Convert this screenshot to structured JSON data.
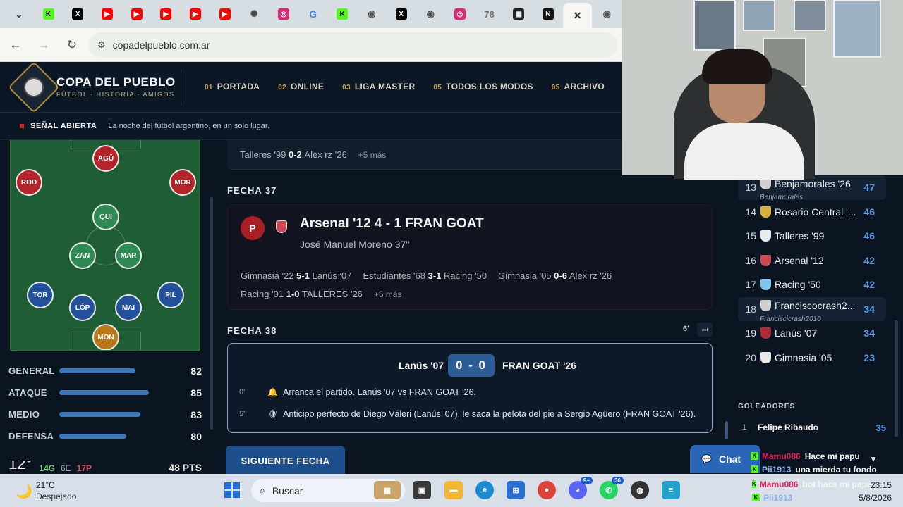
{
  "browser": {
    "tabs": [
      {
        "icon": "expand-tabs-icon",
        "color": "#3a8a3a",
        "glyph": "⌄"
      },
      {
        "icon": "kick-icon",
        "color": "#53fc18",
        "glyph": "K"
      },
      {
        "icon": "x-icon",
        "color": "#000000",
        "glyph": "X"
      },
      {
        "icon": "youtube-icon",
        "color": "#ff0000",
        "glyph": "▶"
      },
      {
        "icon": "youtube-icon",
        "color": "#ff0000",
        "glyph": "▶"
      },
      {
        "icon": "youtube-icon",
        "color": "#ff0000",
        "glyph": "▶"
      },
      {
        "icon": "youtube-icon",
        "color": "#ff0000",
        "glyph": "▶"
      },
      {
        "icon": "youtube-icon",
        "color": "#ff0000",
        "glyph": "▶"
      },
      {
        "icon": "openai-icon",
        "color": "#444444",
        "glyph": "✺"
      },
      {
        "icon": "instagram-icon",
        "color": "#d62976",
        "glyph": "◎"
      },
      {
        "icon": "google-icon",
        "color": "#4285f4",
        "glyph": "G"
      },
      {
        "icon": "kick-icon",
        "color": "#53fc18",
        "glyph": "K"
      },
      {
        "icon": "chrome-icon",
        "color": "#555555",
        "glyph": "◉"
      },
      {
        "icon": "x-icon",
        "color": "#000000",
        "glyph": "X"
      },
      {
        "icon": "chrome-icon",
        "color": "#555555",
        "glyph": "◉"
      },
      {
        "icon": "instagram-icon",
        "color": "#d62976",
        "glyph": "◎"
      },
      {
        "icon": "site-icon",
        "color": "#777777",
        "glyph": "78"
      },
      {
        "icon": "grid-icon",
        "color": "#222222",
        "glyph": "▦"
      },
      {
        "icon": "site-icon",
        "color": "#111111",
        "glyph": "N"
      },
      {
        "icon": "close-icon",
        "color": "#333333",
        "glyph": "✕",
        "active": true
      },
      {
        "icon": "chrome-icon",
        "color": "#555555",
        "glyph": "◉"
      }
    ],
    "url": "copadelpueblo.com.ar"
  },
  "site": {
    "brand_title": "COPA DEL PUEBLO",
    "brand_sub": "FÚTBOL · HISTORIA · AMIGOS",
    "nav": [
      {
        "num": "01",
        "label": "PORTADA"
      },
      {
        "num": "02",
        "label": "ONLINE"
      },
      {
        "num": "03",
        "label": "LIGA MASTER"
      },
      {
        "num": "05",
        "label": "TODOS LOS MODOS"
      },
      {
        "num": "05",
        "label": "ARCHIVO"
      }
    ],
    "ticker_label": "SEÑAL ABIERTA",
    "ticker_text": "La noche del fútbol argentino, en un solo lugar."
  },
  "pitch": {
    "players": [
      {
        "code": "AGÜ",
        "color": "red"
      },
      {
        "code": "ROD",
        "color": "red"
      },
      {
        "code": "MOR",
        "color": "red"
      },
      {
        "code": "QUI",
        "color": "green"
      },
      {
        "code": "ZAN",
        "color": "green"
      },
      {
        "code": "MAR",
        "color": "green"
      },
      {
        "code": "TOR",
        "color": "blue"
      },
      {
        "code": "PIL",
        "color": "blue"
      },
      {
        "code": "LÓP",
        "color": "blue"
      },
      {
        "code": "MAI",
        "color": "blue"
      },
      {
        "code": "MON",
        "color": "gold"
      }
    ]
  },
  "stats": [
    {
      "label": "GENERAL",
      "value": "82",
      "fill": 0.84
    },
    {
      "label": "ATAQUE",
      "value": "85",
      "fill": 0.99
    },
    {
      "label": "MEDIO",
      "value": "83",
      "fill": 0.9
    },
    {
      "label": "DEFENSA",
      "value": "80",
      "fill": 0.74
    }
  ],
  "team_summary": {
    "temp": "12°",
    "g": "14G",
    "e": "6E",
    "p": "17P",
    "pts": "48 PTS"
  },
  "prev_results": {
    "home": "Talleres '99",
    "score": "0-2",
    "away": "Alex rz '26",
    "more": "+5 más"
  },
  "fecha37": {
    "heading": "FECHA 37",
    "badge": "P",
    "score_line": "Arsenal '12 4 - 1 FRAN GOAT",
    "scorer": "José Manuel Moreno 37''",
    "results": [
      {
        "home": "Gimnasia '22",
        "score": "5-1",
        "away": "Lanús '07"
      },
      {
        "home": "Estudiantes '68",
        "score": "3-1",
        "away": "Racing '50"
      },
      {
        "home": "Gimnasia '05",
        "score": "0-6",
        "away": "Alex rz '26"
      },
      {
        "home": "Racing '01",
        "score": "1-0",
        "away": "TALLERES '26"
      }
    ],
    "more": "+5 más"
  },
  "fecha38": {
    "heading": "FECHA 38",
    "minute": "6'",
    "home": "Lanús '07",
    "score": "0 - 0",
    "away": "FRAN GOAT '26",
    "events": [
      {
        "min": "0'",
        "icon": "bell-icon",
        "text": "Arranca el partido. Lanús '07 vs FRAN GOAT '26."
      },
      {
        "min": "5'",
        "icon": "shield-icon",
        "text": "Anticipo perfecto de Diego Váleri (Lanús '07), le saca la pelota del pie a Sergio Agüero (FRAN GOAT '26)."
      }
    ]
  },
  "next_button": "SIGUIENTE FECHA",
  "standings": [
    {
      "pos": "13",
      "team": "Benjamorales '26",
      "sub": "Benjamorales",
      "pts": "47",
      "crest": "#cfcfcf",
      "highlight": true
    },
    {
      "pos": "14",
      "team": "Rosario Central '...",
      "pts": "46",
      "crest": "#d6b23a"
    },
    {
      "pos": "15",
      "team": "Talleres '99",
      "pts": "46",
      "crest": "#e8e8e8"
    },
    {
      "pos": "16",
      "team": "Arsenal '12",
      "pts": "42",
      "crest": "#c94a52"
    },
    {
      "pos": "17",
      "team": "Racing '50",
      "pts": "42",
      "crest": "#7fc2ec"
    },
    {
      "pos": "18",
      "team": "Franciscocrash2...",
      "sub": "Franciscicrash2010",
      "pts": "34",
      "crest": "#cfcfcf",
      "highlight": true
    },
    {
      "pos": "19",
      "team": "Lanús '07",
      "pts": "34",
      "crest": "#b02a3a"
    },
    {
      "pos": "20",
      "team": "Gimnasia '05",
      "pts": "23",
      "crest": "#e8e8e8"
    }
  ],
  "goleadores": {
    "heading": "GOLEADORES",
    "items": [
      {
        "pos": "1",
        "name": "Felipe Ribaudo",
        "goals": "35"
      }
    ]
  },
  "chat": {
    "button": "Chat",
    "messages": [
      {
        "user": "Mamu086",
        "text": "Hace mi papu",
        "color": "#e0245e"
      },
      {
        "user": "Pii1913",
        "text": "una mierda tu fondo",
        "color": "#8ab4f8"
      }
    ],
    "tray_messages": [
      {
        "user": "Mamu086",
        "text": "bot hace mi papu",
        "color": "#e0245e"
      },
      {
        "user": "Pii1913",
        "text": "",
        "color": "#8ab4f8"
      }
    ]
  },
  "taskbar": {
    "weather_temp": "21°C",
    "weather_desc": "Despejado",
    "search": "Buscar",
    "time": "23:15",
    "date": "5/8/2026",
    "badges": {
      "discord": "9+",
      "whatsapp": "36"
    }
  }
}
